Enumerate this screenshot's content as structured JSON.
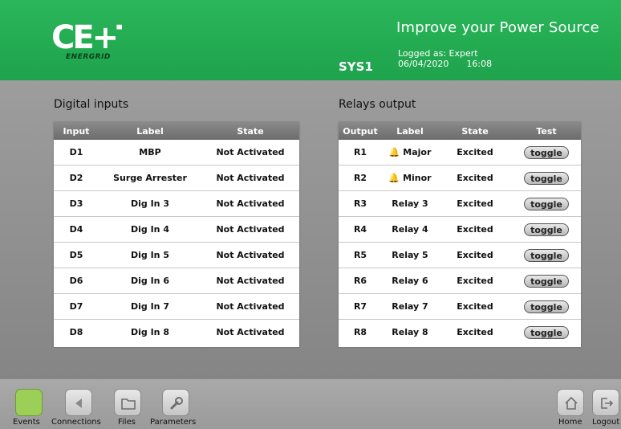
{
  "header": {
    "logo_text": "CE+T",
    "logo_subtext": "ENERGRID",
    "system_name": "SYS1",
    "logged_as": "Logged as: Expert",
    "date": "06/04/2020",
    "time": "16:08",
    "tagline": "Improve your Power Source",
    "colors": {
      "header_green": "#1ea34c"
    }
  },
  "digital_inputs": {
    "title": "Digital inputs",
    "columns": [
      "Input",
      "Label",
      "State"
    ],
    "rows": [
      {
        "input": "D1",
        "label": "MBP",
        "state": "Not Activated"
      },
      {
        "input": "D2",
        "label": "Surge Arrester",
        "state": "Not Activated"
      },
      {
        "input": "D3",
        "label": "Dig In 3",
        "state": "Not Activated"
      },
      {
        "input": "D4",
        "label": "Dig In 4",
        "state": "Not Activated"
      },
      {
        "input": "D5",
        "label": "Dig In 5",
        "state": "Not Activated"
      },
      {
        "input": "D6",
        "label": "Dig In 6",
        "state": "Not Activated"
      },
      {
        "input": "D7",
        "label": "Dig In 7",
        "state": "Not Activated"
      },
      {
        "input": "D8",
        "label": "Dig In 8",
        "state": "Not Activated"
      }
    ]
  },
  "relays_output": {
    "title": "Relays output",
    "columns": [
      "Output",
      "Label",
      "State",
      "Test"
    ],
    "rows": [
      {
        "output": "R1",
        "label": "Major",
        "state": "Excited",
        "test": "toggle",
        "icon": "bell-icon"
      },
      {
        "output": "R2",
        "label": "Minor",
        "state": "Excited",
        "test": "toggle",
        "icon": "bell-icon"
      },
      {
        "output": "R3",
        "label": "Relay 3",
        "state": "Excited",
        "test": "toggle"
      },
      {
        "output": "R4",
        "label": "Relay 4",
        "state": "Excited",
        "test": "toggle"
      },
      {
        "output": "R5",
        "label": "Relay 5",
        "state": "Excited",
        "test": "toggle"
      },
      {
        "output": "R6",
        "label": "Relay 6",
        "state": "Excited",
        "test": "toggle"
      },
      {
        "output": "R7",
        "label": "Relay 7",
        "state": "Excited",
        "test": "toggle"
      },
      {
        "output": "R8",
        "label": "Relay 8",
        "state": "Excited",
        "test": "toggle"
      }
    ]
  },
  "footer": {
    "left_buttons": [
      {
        "label": "Events",
        "icon": "events-icon",
        "active": true
      },
      {
        "label": "Connections",
        "icon": "connections-icon"
      },
      {
        "label": "Files",
        "icon": "folder-icon"
      },
      {
        "label": "Parameters",
        "icon": "wrench-icon"
      }
    ],
    "right_buttons": [
      {
        "label": "Home",
        "icon": "home-icon"
      },
      {
        "label": "Logout",
        "icon": "logout-icon"
      }
    ],
    "colors": {
      "active_green": "#9ccf57"
    }
  }
}
